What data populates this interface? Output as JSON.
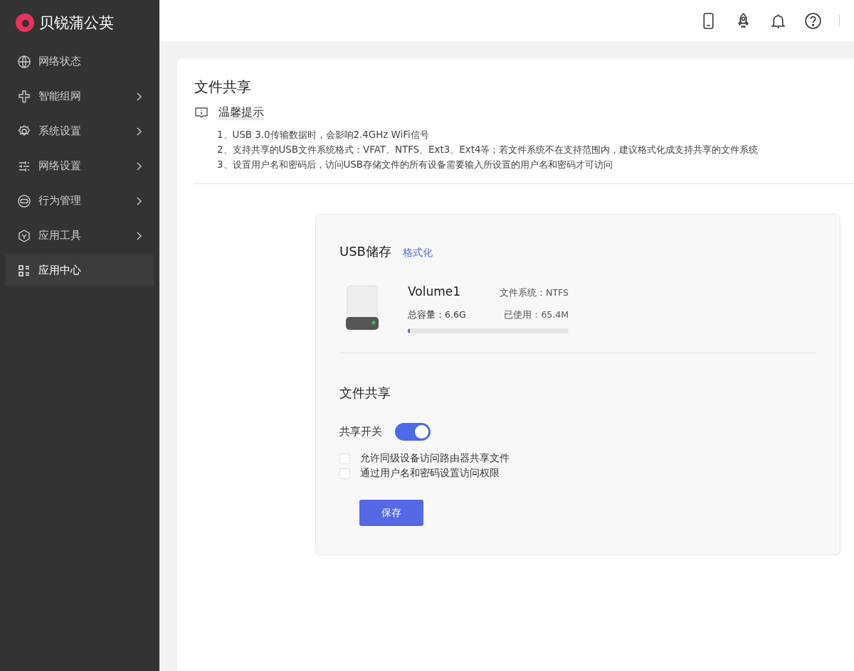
{
  "brand": {
    "name": "贝锐蒲公英"
  },
  "sidebar": {
    "items": [
      {
        "label": "网络状态",
        "expandable": false,
        "selected": false
      },
      {
        "label": "智能组网",
        "expandable": true,
        "selected": false
      },
      {
        "label": "系统设置",
        "expandable": true,
        "selected": false
      },
      {
        "label": "网络设置",
        "expandable": true,
        "selected": false
      },
      {
        "label": "行为管理",
        "expandable": true,
        "selected": false
      },
      {
        "label": "应用工具",
        "expandable": true,
        "selected": false
      },
      {
        "label": "应用中心",
        "expandable": false,
        "selected": true
      }
    ]
  },
  "page": {
    "title": "文件共享",
    "tips": {
      "title": "温馨提示",
      "lines": [
        "1、USB 3.0传输数据时，会影响2.4GHz WiFi信号",
        "2、支持共享的USB文件系统格式：VFAT、NTFS、Ext3、Ext4等；若文件系统不在支持范围内，建议格式化成支持共享的文件系统",
        "3、设置用户名和密码后，访问USB存储文件的所有设备需要输入所设置的用户名和密码才可访问"
      ]
    }
  },
  "usb": {
    "title": "USB储存",
    "format_link": "格式化",
    "volume": {
      "name": "Volume1",
      "filesystem": "文件系统：NTFS",
      "capacity": "总容量：6.6G",
      "used": "已使用：65.4M",
      "level": 0.01
    }
  },
  "sharing": {
    "title": "文件共享",
    "switch_label": "共享开关",
    "switch_on": true,
    "options": [
      {
        "label": "允许同级设备访问路由器共享文件",
        "checked": false
      },
      {
        "label": "通过用户名和密码设置访问权限",
        "checked": false
      }
    ],
    "save_button": "保存"
  }
}
